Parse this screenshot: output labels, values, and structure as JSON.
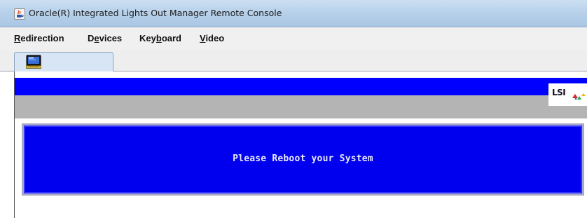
{
  "window": {
    "title": "Oracle(R) Integrated Lights Out Manager Remote Console",
    "app_icon": "java-coffee-icon"
  },
  "menubar": {
    "items": [
      {
        "label_first": "R",
        "label_rest": "edirection"
      },
      {
        "label_first": "D",
        "label_mid_pre": "",
        "label_ul": "e",
        "label_rest": "vices"
      },
      {
        "label_pre": "Key",
        "label_ul": "b",
        "label_rest": "oard"
      },
      {
        "label_first": "V",
        "label_rest": "ideo"
      }
    ]
  },
  "tabs": [
    {
      "icon": "console-screen-icon",
      "selected": true
    }
  ],
  "console": {
    "logo_text": "LSI",
    "logo_icon": "lsi-logo-mark",
    "dialog_message": "Please Reboot your System",
    "colors": {
      "bios_blue": "#0000ff",
      "bios_gray": "#b4b4b4",
      "dialog_blue": "#0000ee"
    }
  }
}
